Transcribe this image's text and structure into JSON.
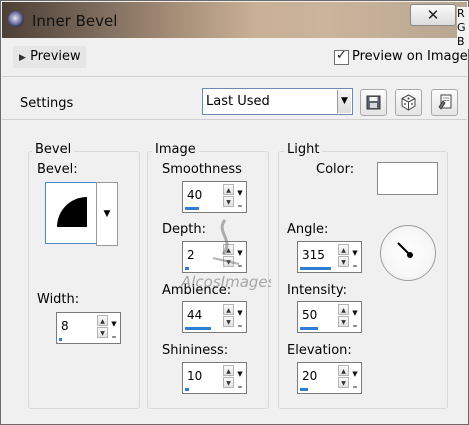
{
  "window": {
    "title": "Inner Bevel",
    "side_letters": [
      "R",
      "G",
      "B"
    ]
  },
  "preview": {
    "button_label": "Preview",
    "checkbox_label": "Preview on Image",
    "checked": true
  },
  "settings": {
    "label": "Settings",
    "preset_value": "Last Used"
  },
  "toolbar": {
    "icons": [
      "save-preset-icon",
      "randomize-icon",
      "reset-icon"
    ]
  },
  "bevel_group": {
    "title": "Bevel",
    "bevel_label": "Bevel:",
    "width_label": "Width:",
    "width_value": "8",
    "width_fill": 0.08
  },
  "image_group": {
    "title": "Image",
    "smoothness": {
      "label": "Smoothness",
      "value": "40",
      "fill": 0.4
    },
    "depth": {
      "label": "Depth:",
      "value": "2",
      "fill": 0.1
    },
    "ambience": {
      "label": "Ambience:",
      "value": "44",
      "fill": 0.72
    },
    "shininess": {
      "label": "Shininess:",
      "value": "10",
      "fill": 0.1
    }
  },
  "light_group": {
    "title": "Light",
    "color_label": "Color:",
    "color_value": "#ffffff",
    "angle": {
      "label": "Angle:",
      "value": "315",
      "fill": 0.87
    },
    "intensity": {
      "label": "Intensity:",
      "value": "50",
      "fill": 0.5
    },
    "elevation": {
      "label": "Elevation:",
      "value": "20",
      "fill": 0.22
    }
  },
  "watermark": {
    "text": "AlcosImages"
  }
}
